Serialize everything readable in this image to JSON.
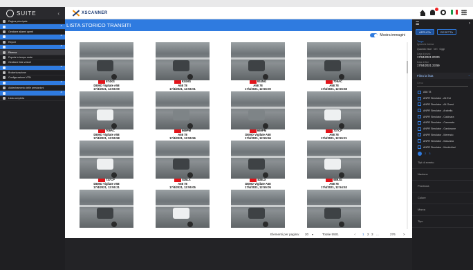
{
  "sidebar": {
    "brand": "SUITE",
    "items": [
      {
        "label": "Pagina principale",
        "type": "item"
      },
      {
        "label": "",
        "type": "group"
      },
      {
        "label": "Gestione allarmi aperti",
        "type": "item"
      },
      {
        "label": "",
        "type": "group"
      },
      {
        "label": "Report",
        "type": "item"
      },
      {
        "label": "",
        "type": "group"
      },
      {
        "label": "Ricerca",
        "type": "active"
      },
      {
        "label": "Popola in tempo reale",
        "type": "item"
      },
      {
        "label": "Gestione liste veicoli",
        "type": "item"
      },
      {
        "label": "",
        "type": "group"
      },
      {
        "label": "Brokerizzazione",
        "type": "item"
      },
      {
        "label": "Configurazione VPN",
        "type": "item"
      },
      {
        "label": "",
        "type": "group"
      },
      {
        "label": "Addestramento delle prestazioni",
        "type": "item"
      },
      {
        "label": "",
        "type": "group"
      },
      {
        "label": "Lista completa",
        "type": "item"
      }
    ]
  },
  "topbar": {
    "app_name": "XSCANNER"
  },
  "main": {
    "title": "LISTA STORICO TRANSITI",
    "toggle_label": "Mostra immagini"
  },
  "gallery": {
    "cards": [
      {
        "plate": "674XS",
        "line2": "DEMO Vigilate A58",
        "line3": "17/4/2021, 12:56:09",
        "vehicle": "dark"
      },
      {
        "plate": "924NG",
        "line2": "A58 78",
        "line3": "17/4/2021, 12:56:01",
        "vehicle": "dark"
      },
      {
        "plate": "924NG",
        "line2": "A58 78",
        "line3": "17/4/2021, 12:56:00",
        "vehicle": "dark"
      },
      {
        "plate": "709AC",
        "line2": "A58 78",
        "line3": "17/4/2021, 12:55:58",
        "vehicle": "dark"
      },
      {
        "plate": "709AC",
        "line2": "DEMO Vigilate A58",
        "line3": "17/4/2021, 12:55:58",
        "vehicle": "white"
      },
      {
        "plate": "669PM",
        "line2": "A58 78",
        "line3": "17/4/2021, 12:55:56",
        "vehicle": "grey"
      },
      {
        "plate": "669PM",
        "line2": "DEMO Vigilate A58",
        "line3": "17/4/2021, 12:55:56",
        "vehicle": "grey"
      },
      {
        "plate": "737CP",
        "line2": "A58 78",
        "line3": "17/4/2021, 12:55:21",
        "vehicle": "white"
      },
      {
        "plate": "737CP",
        "line2": "DEMO Vigilate A58",
        "line3": "17/4/2021, 12:55:21",
        "vehicle": "white"
      },
      {
        "plate": "835LX",
        "line2": "A58 78",
        "line3": "17/4/2021, 12:55:05",
        "vehicle": "dark"
      },
      {
        "plate": "835LX",
        "line2": "DEMO Vigilate A58",
        "line3": "17/4/2021, 12:55:05",
        "vehicle": "dark"
      },
      {
        "plate": "689JG",
        "line2": "A58 78",
        "line3": "17/4/2021, 12:54:53",
        "vehicle": "white"
      },
      {
        "plate": "",
        "line2": "",
        "line3": "",
        "vehicle": "dark"
      },
      {
        "plate": "",
        "line2": "",
        "line3": "",
        "vehicle": "white"
      },
      {
        "plate": "",
        "line2": "",
        "line3": "",
        "vehicle": "dark"
      },
      {
        "plate": "",
        "line2": "",
        "line3": "",
        "vehicle": "dark"
      }
    ]
  },
  "paginator": {
    "label": "Elementi per pagina:",
    "page_size": "20",
    "total": "Totale 5501",
    "pages": [
      "1",
      "2",
      "3"
    ],
    "dots": "...",
    "last": "276",
    "prev": "<",
    "next": ">"
  },
  "filters": {
    "apply": "APPLICA",
    "reset": "RESETTA",
    "targa_label": "Targa",
    "targa_sub": "Ignora la ricerca",
    "tabs": [
      "Quando esce",
      "Ieri",
      "Oggi"
    ],
    "date_from_label": "Data di inizio",
    "date_from": "17/04/2021 00:00",
    "date_to_label": "Data di fine",
    "date_to": "17/04/2021 23:59",
    "list_header": "Filtra la lista",
    "search_placeholder": "Cerca",
    "list_items": [
      "A58 78",
      "ANPR Simulator - A4 Est",
      "ANPR Simulator - A4 Ovest",
      "ANPR Simulator - Arabella",
      "ANPR Simulator - Calcinara",
      "ANPR Simulator - Camerata",
      "ANPR Simulator - Gardosone",
      "ANPR Simulator - Merendo",
      "ANPR Simulator - Mazzana",
      "ANPR Simulator - Montichiari"
    ],
    "list_pages": [
      "1",
      "2",
      "3"
    ],
    "fields": [
      "Tipi di evento",
      "Nazione",
      "Provincia",
      "Colore",
      "Marca",
      "Tipo"
    ]
  },
  "colors": {
    "accent": "#2f7be0",
    "sidebar_bg": "#1f1f22",
    "plate_red": "#e3141a"
  }
}
